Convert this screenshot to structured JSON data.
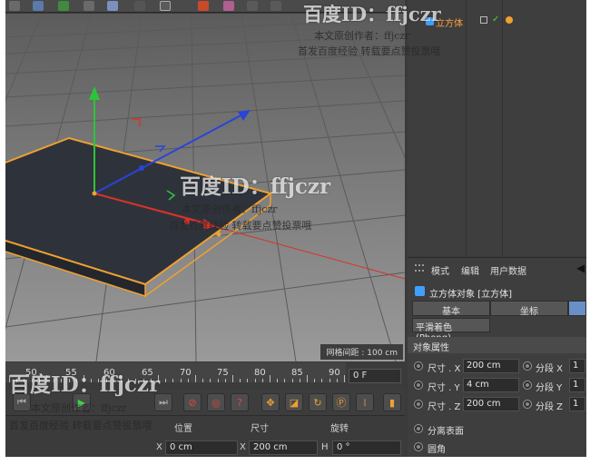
{
  "object_manager": {
    "object_name": "立方体"
  },
  "viewport": {
    "grid_spacing": "网格间距 : 100 cm"
  },
  "timeline": {
    "ruler_labels": [
      "50",
      "55",
      "60",
      "65",
      "70",
      "75",
      "80",
      "85",
      "90"
    ],
    "current_frame": "0 F"
  },
  "coordinates": {
    "col_position": "位置",
    "col_size": "尺寸",
    "col_rotation": "旋转",
    "pos_x_label": "X",
    "pos_x_value": "0 cm",
    "size_x_label": "X",
    "size_x_value": "200 cm",
    "rot_h_label": "H",
    "rot_h_value": "0 °"
  },
  "attributes": {
    "menu": [
      "模式",
      "编辑",
      "用户数据"
    ],
    "object_title": "立方体对象 [立方体]",
    "tabs": [
      "基本",
      "坐标",
      ""
    ],
    "phong_tab": "平滑着色(Phong)",
    "section_title": "对象属性",
    "size_x_label": "尺寸 . X",
    "size_x_value": "200 cm",
    "size_y_label": "尺寸 . Y",
    "size_y_value": "4 cm",
    "size_z_label": "尺寸 . Z",
    "size_z_value": "200 cm",
    "seg_x_label": "分段 X",
    "seg_x_value": "1",
    "seg_y_label": "分段 Y",
    "seg_y_value": "1",
    "seg_z_label": "分段 Z",
    "seg_z_value": "1",
    "separate_surfaces": "分离表面",
    "fillet": "圆角"
  },
  "watermarks": {
    "id_text": "百度ID：ffjczr",
    "author_line": "本文原创作者：ffjczr",
    "cta_line": "首发百度经验 转载要点赞投票哦"
  },
  "colors": {
    "accent_orange": "#f0a030",
    "axis_red": "#d8322a",
    "axis_green": "#2ec43a",
    "axis_blue": "#2a44d8"
  }
}
